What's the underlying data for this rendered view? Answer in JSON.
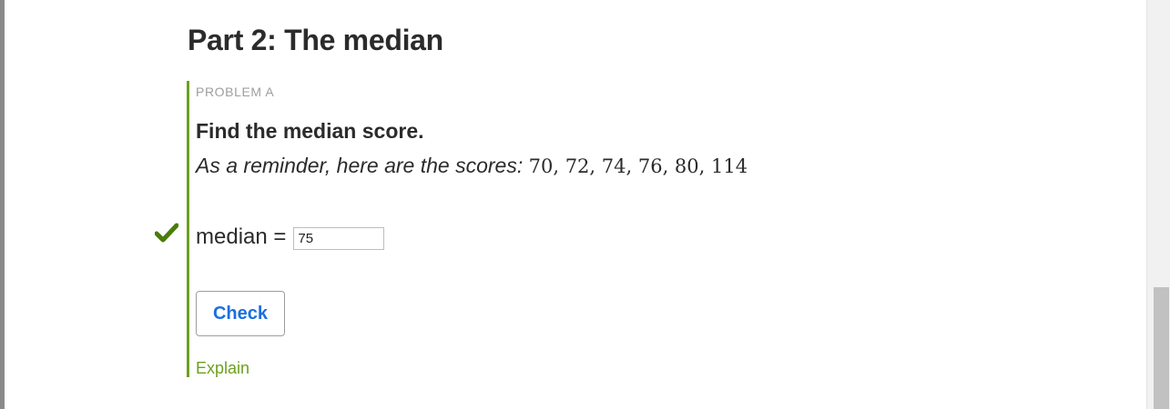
{
  "section": {
    "title": "Part 2: The median"
  },
  "problem": {
    "label": "PROBLEM A",
    "question": "Find the median score.",
    "reminder_text": "As a reminder, here are the scores:",
    "scores_text": "70, 72, 74, 76, 80, 114",
    "answer_label": "median =",
    "answer_value": "75",
    "answer_status": "correct",
    "check_label": "Check",
    "explain_label": "Explain"
  },
  "icons": {
    "status": "checkmark-icon"
  },
  "colors": {
    "accent_green": "#6ca01f",
    "check_green": "#4a7d08",
    "button_blue": "#1a6fe0",
    "text": "#2b2b2b",
    "muted": "#9e9e9e"
  }
}
